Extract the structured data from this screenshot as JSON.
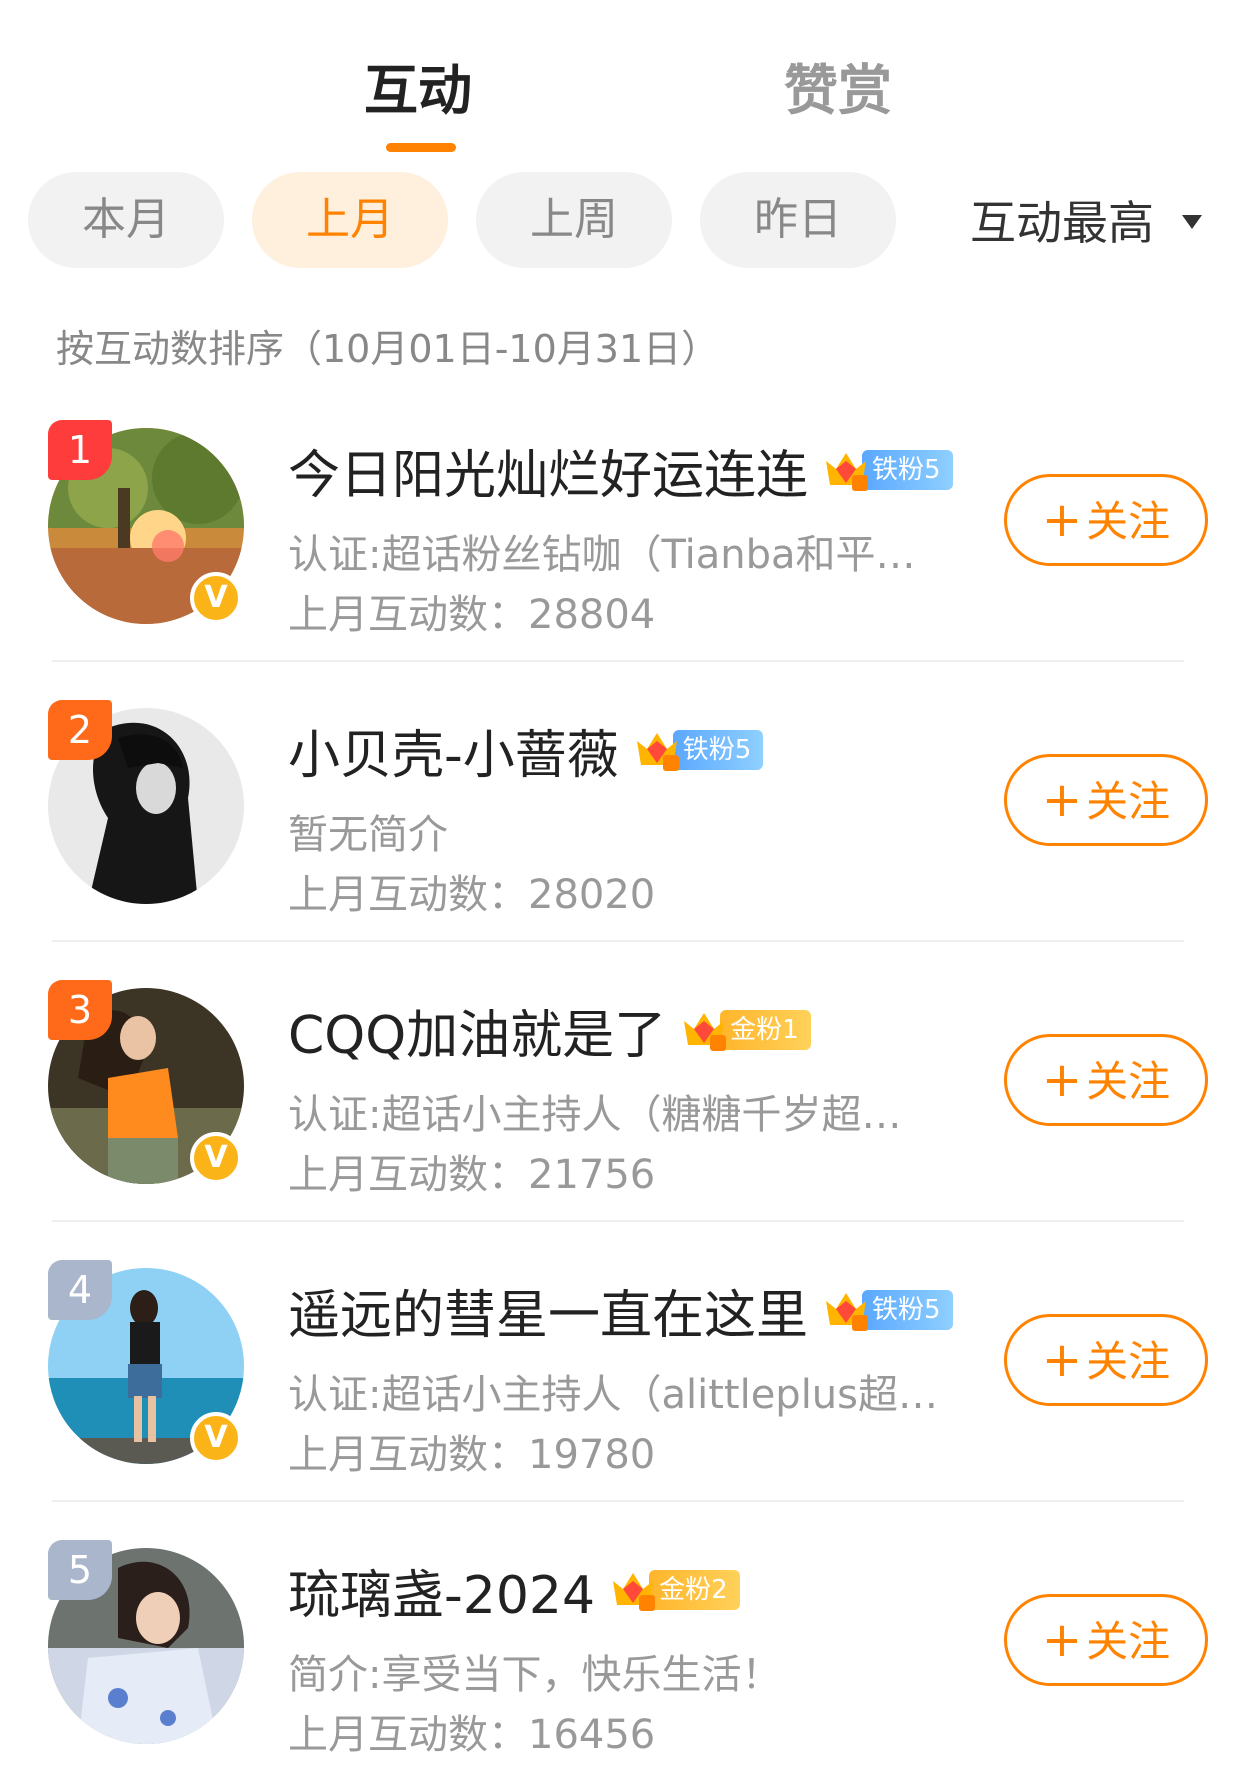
{
  "top_tabs": [
    {
      "label": "互动",
      "active": true
    },
    {
      "label": "赞赏",
      "active": false
    }
  ],
  "filters": [
    {
      "label": "本月",
      "active": false
    },
    {
      "label": "上月",
      "active": true
    },
    {
      "label": "上周",
      "active": false
    },
    {
      "label": "昨日",
      "active": false
    }
  ],
  "sort": {
    "label": "互动最高"
  },
  "sort_hint": "按互动数排序（10月01日-10月31日）",
  "follow_label": "关注",
  "colors": {
    "accent": "#ff8200",
    "rank_top": "#ff3c3c",
    "rank_2_3": "#ff6a1a",
    "rank_rest": "#aab6cc"
  },
  "users": [
    {
      "rank": "1",
      "name": "今日阳光灿烂好运连连",
      "crown_level": "5",
      "fan_badge": "铁粉5",
      "fan_type": "iron",
      "verified": true,
      "desc": "认证:超话粉丝钻咖（Tianba和平…",
      "count": "上月互动数：28804"
    },
    {
      "rank": "2",
      "name": "小贝壳-小蔷薇",
      "crown_level": "6",
      "fan_badge": "铁粉5",
      "fan_type": "iron",
      "verified": false,
      "desc": "暂无简介",
      "count": "上月互动数：28020"
    },
    {
      "rank": "3",
      "name": "CQQ加油就是了",
      "crown_level": "6",
      "fan_badge": "金粉1",
      "fan_type": "gold",
      "verified": true,
      "desc": "认证:超话小主持人（糖糖千岁超…",
      "count": "上月互动数：21756"
    },
    {
      "rank": "4",
      "name": "遥远的彗星一直在这里",
      "crown_level": "5",
      "fan_badge": "铁粉5",
      "fan_type": "iron",
      "verified": true,
      "desc": "认证:超话小主持人（alittleplus超…",
      "count": "上月互动数：19780"
    },
    {
      "rank": "5",
      "name": "琉璃盏-2024",
      "crown_level": "4",
      "fan_badge": "金粉2",
      "fan_type": "gold",
      "verified": false,
      "desc": "简介:享受当下，快乐生活！",
      "count": "上月互动数：16456"
    }
  ]
}
